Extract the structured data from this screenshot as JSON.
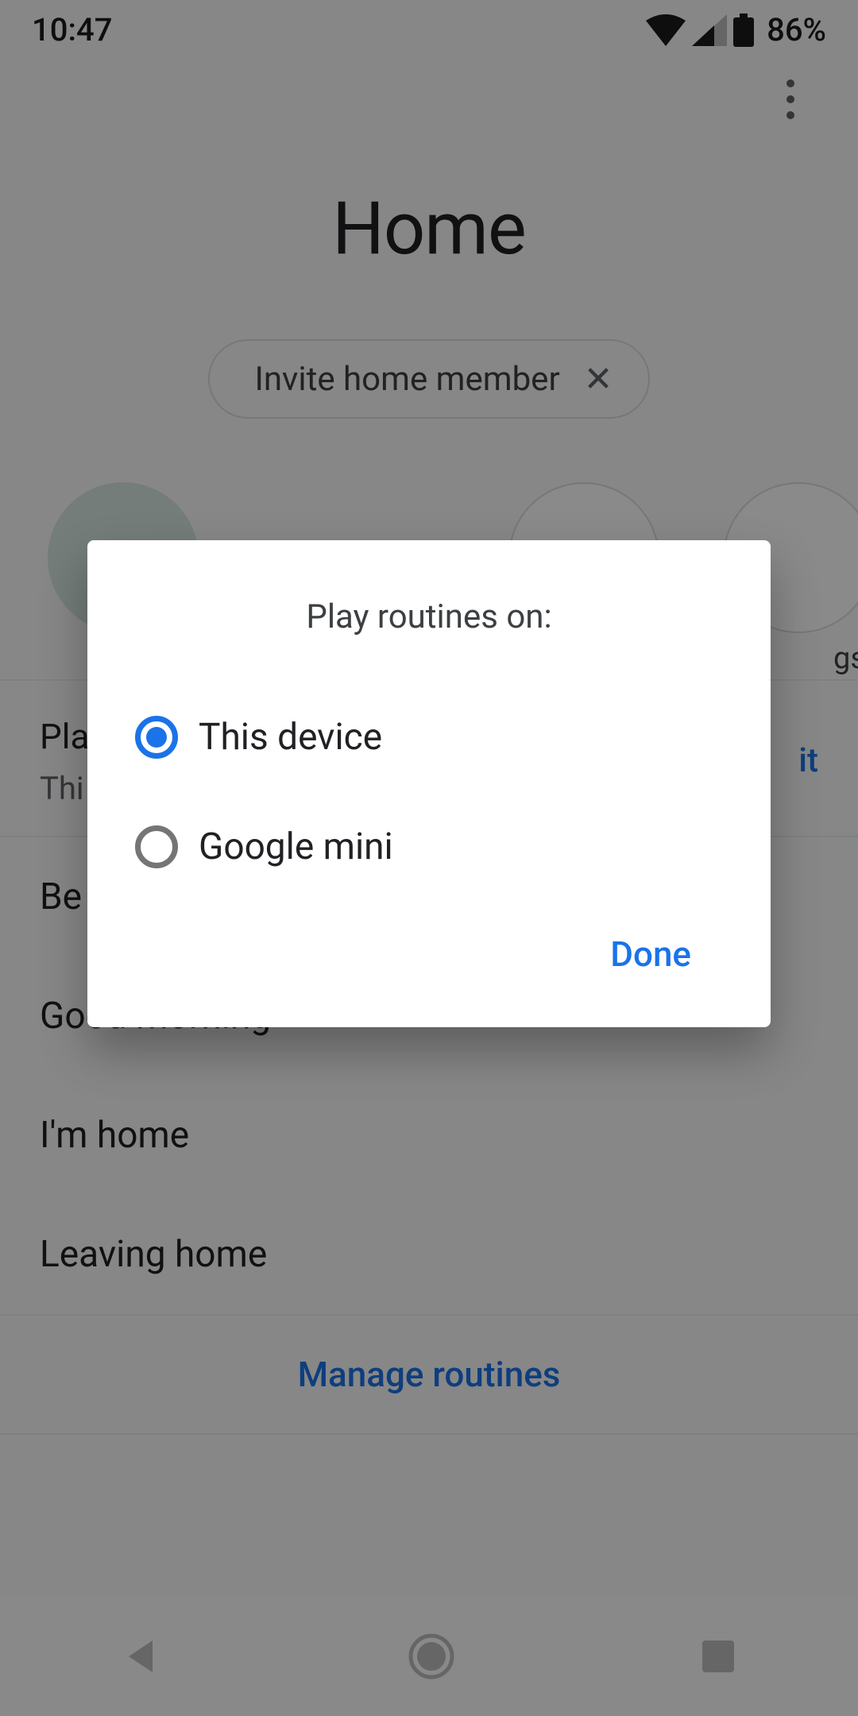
{
  "status": {
    "time": "10:47",
    "battery": "86%"
  },
  "header": {
    "title": "Home",
    "invite_label": "Invite home member"
  },
  "shortcut_label_fragment": "gs",
  "routines": {
    "section_title_fragment": "Pla",
    "section_sub_fragment": "Thi",
    "edit_fragment": "it",
    "items": [
      {
        "label": "Be"
      },
      {
        "label": "Good morning"
      },
      {
        "label": "I'm home"
      },
      {
        "label": "Leaving home"
      }
    ],
    "manage_label": "Manage routines"
  },
  "dialog": {
    "title": "Play routines on:",
    "options": [
      {
        "label": "This device",
        "selected": true
      },
      {
        "label": "Google mini",
        "selected": false
      }
    ],
    "done": "Done"
  }
}
